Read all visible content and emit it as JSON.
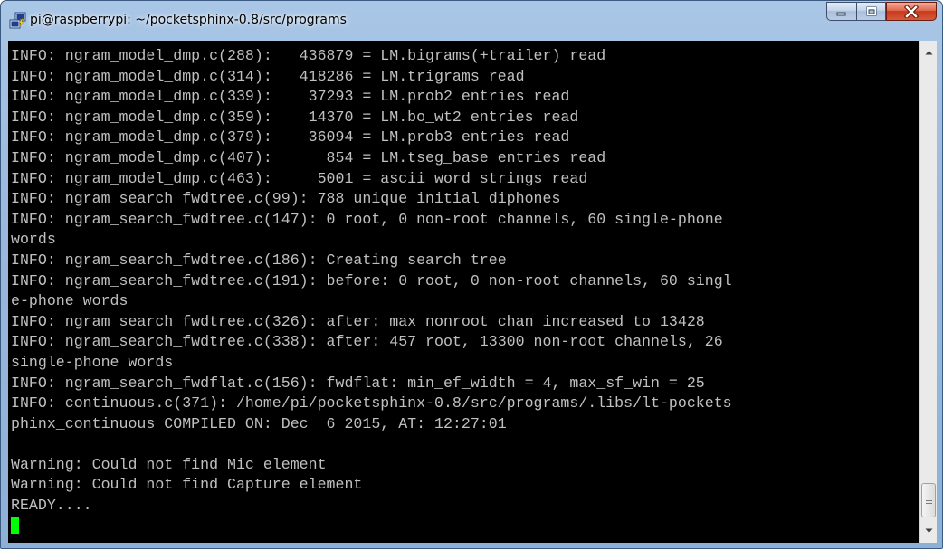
{
  "window": {
    "title": "pi@raspberrypi: ~/pocketsphinx-0.8/src/programs",
    "icon": "putty-icon",
    "controls": [
      "minimize-icon",
      "maximize-icon",
      "close-icon"
    ]
  },
  "terminal": {
    "lines": [
      "INFO: ngram_model_dmp.c(288):   436879 = LM.bigrams(+trailer) read",
      "INFO: ngram_model_dmp.c(314):   418286 = LM.trigrams read",
      "INFO: ngram_model_dmp.c(339):    37293 = LM.prob2 entries read",
      "INFO: ngram_model_dmp.c(359):    14370 = LM.bo_wt2 entries read",
      "INFO: ngram_model_dmp.c(379):    36094 = LM.prob3 entries read",
      "INFO: ngram_model_dmp.c(407):      854 = LM.tseg_base entries read",
      "INFO: ngram_model_dmp.c(463):     5001 = ascii word strings read",
      "INFO: ngram_search_fwdtree.c(99): 788 unique initial diphones",
      "INFO: ngram_search_fwdtree.c(147): 0 root, 0 non-root channels, 60 single-phone",
      "words",
      "INFO: ngram_search_fwdtree.c(186): Creating search tree",
      "INFO: ngram_search_fwdtree.c(191): before: 0 root, 0 non-root channels, 60 singl",
      "e-phone words",
      "INFO: ngram_search_fwdtree.c(326): after: max nonroot chan increased to 13428",
      "INFO: ngram_search_fwdtree.c(338): after: 457 root, 13300 non-root channels, 26",
      "single-phone words",
      "INFO: ngram_search_fwdflat.c(156): fwdflat: min_ef_width = 4, max_sf_win = 25",
      "INFO: continuous.c(371): /home/pi/pocketsphinx-0.8/src/programs/.libs/lt-pockets",
      "phinx_continuous COMPILED ON: Dec  6 2015, AT: 12:27:01",
      "",
      "Warning: Could not find Mic element",
      "Warning: Could not find Capture element",
      "READY...."
    ],
    "text_color": "#c0c0c0",
    "background": "#000000",
    "cursor_color": "#00ff00"
  },
  "scrollbar": {
    "up_icon": "arrow-up-icon",
    "down_icon": "arrow-down-icon",
    "position": 0.96
  },
  "colors": {
    "frame": "#9ab9dc",
    "close_button": "#c63a1c"
  }
}
